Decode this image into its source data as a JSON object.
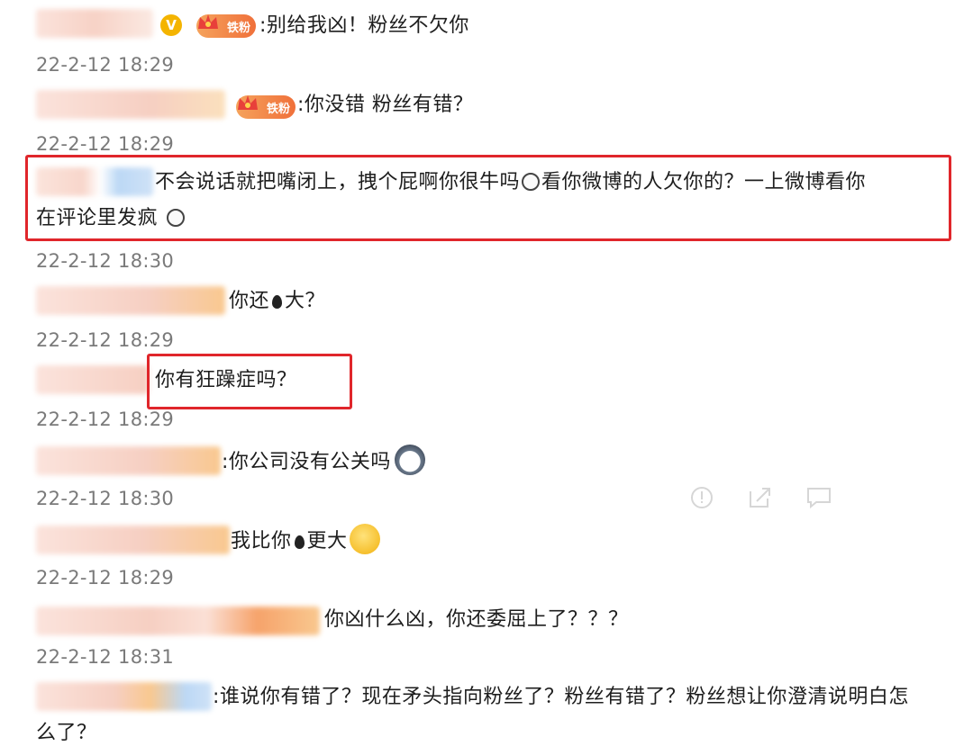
{
  "comments": [
    {
      "text": ":别给我凶！粉丝不欠你",
      "time": "22-2-12 18:29",
      "badge": "铁粉"
    },
    {
      "text": ":你没错  粉丝有错？",
      "time": "22-2-12 18:29",
      "badge": "铁粉"
    },
    {
      "text": "不会说话就把嘴闭上，拽个屁啊你很牛吗",
      "text2": "看你微博的人欠你的？一上微博看你在评论里发疯",
      "time": "22-2-12 18:30"
    },
    {
      "text_a": "你还",
      "text_b": "大？",
      "time": "22-2-12 18:29"
    },
    {
      "text": "你有狂躁症吗？",
      "time": "22-2-12 18:29"
    },
    {
      "text": ":你公司没有公关吗",
      "time": "22-2-12 18:30"
    },
    {
      "text_a": "我比你",
      "text_b": "更大",
      "time": "22-2-12 18:29"
    },
    {
      "text": "你凶什么凶，你还委屈上了？？？",
      "time": "22-2-12 18:31"
    },
    {
      "text": ":谁说你有错了？现在矛头指向粉丝了？粉丝有错了？粉丝想让你澄清说明白怎么了？"
    }
  ],
  "verified_mark": "V",
  "icons": {
    "report": "report-icon",
    "share": "share-icon",
    "comment": "comment-icon"
  },
  "highlight_color": "#e0262b"
}
